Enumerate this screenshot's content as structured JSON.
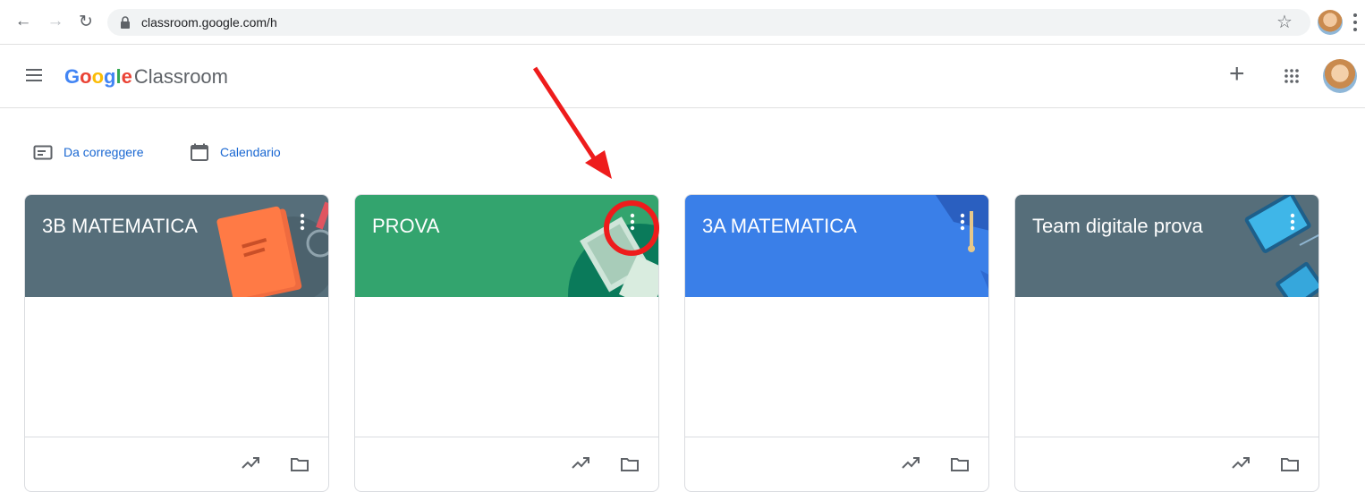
{
  "browser": {
    "url": "classroom.google.com/h"
  },
  "app": {
    "brand_google": [
      "G",
      "o",
      "o",
      "g",
      "l",
      "e"
    ],
    "brand_colors": [
      "#4285F4",
      "#EA4335",
      "#FBBC05",
      "#4285F4",
      "#34A853",
      "#EA4335"
    ],
    "brand_product": "Classroom"
  },
  "links": {
    "to_review": "Da correggere",
    "calendar": "Calendario"
  },
  "classes": [
    {
      "title": "3B MATEMATICA",
      "color": "#566e7a"
    },
    {
      "title": "PROVA",
      "color": "#33a46e"
    },
    {
      "title": "3A MATEMATICA",
      "color": "#3a7fe8"
    },
    {
      "title": "Team digitale prova",
      "color": "#566e7a"
    }
  ],
  "icons": {
    "trend": "trending-up-icon",
    "folder": "folder-icon",
    "more": "more-vert-icon"
  },
  "annotation_color": "#ee1c1c"
}
